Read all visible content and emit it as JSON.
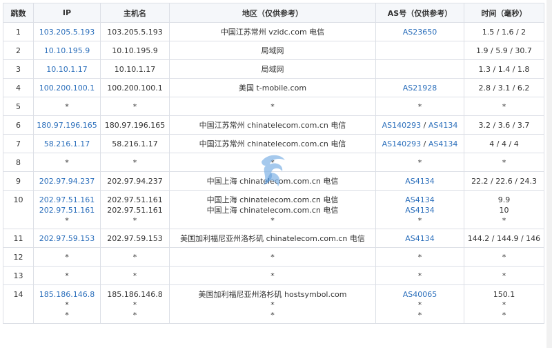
{
  "headers": {
    "hop": "跳数",
    "ip": "IP",
    "host": "主机名",
    "region": "地区（仅供参考）",
    "as": "AS号（仅供参考）",
    "time": "时间（毫秒）"
  },
  "rows": [
    {
      "hop": "1",
      "ips": [
        "103.205.5.193"
      ],
      "hosts": [
        "103.205.5.193"
      ],
      "regions": [
        "中国江苏常州 vzidc.com 电信"
      ],
      "as": [
        [
          "AS23650"
        ]
      ],
      "times": [
        "1.5 / 1.6 / 2"
      ]
    },
    {
      "hop": "2",
      "ips": [
        "10.10.195.9"
      ],
      "hosts": [
        "10.10.195.9"
      ],
      "regions": [
        "局域网"
      ],
      "as": [
        []
      ],
      "times": [
        "1.9 / 5.9 / 30.7"
      ]
    },
    {
      "hop": "3",
      "ips": [
        "10.10.1.17"
      ],
      "hosts": [
        "10.10.1.17"
      ],
      "regions": [
        "局域网"
      ],
      "as": [
        []
      ],
      "times": [
        "1.3 / 1.4 / 1.8"
      ]
    },
    {
      "hop": "4",
      "ips": [
        "100.200.100.1"
      ],
      "hosts": [
        "100.200.100.1"
      ],
      "regions": [
        "美国 t-mobile.com"
      ],
      "as": [
        [
          "AS21928"
        ]
      ],
      "times": [
        "2.8 / 3.1 / 6.2"
      ]
    },
    {
      "hop": "5",
      "ips": [
        "*"
      ],
      "hosts": [
        "*"
      ],
      "regions": [
        "*"
      ],
      "as": [
        [
          "*"
        ]
      ],
      "times": [
        "*"
      ]
    },
    {
      "hop": "6",
      "ips": [
        "180.97.196.165"
      ],
      "hosts": [
        "180.97.196.165"
      ],
      "regions": [
        "中国江苏常州 chinatelecom.com.cn 电信"
      ],
      "as": [
        [
          "AS140293",
          "AS4134"
        ]
      ],
      "times": [
        "3.2 / 3.6 / 3.7"
      ]
    },
    {
      "hop": "7",
      "ips": [
        "58.216.1.17"
      ],
      "hosts": [
        "58.216.1.17"
      ],
      "regions": [
        "中国江苏常州 chinatelecom.com.cn 电信"
      ],
      "as": [
        [
          "AS140293",
          "AS4134"
        ]
      ],
      "times": [
        "4 / 4 / 4"
      ]
    },
    {
      "hop": "8",
      "ips": [
        "*"
      ],
      "hosts": [
        "*"
      ],
      "regions": [
        "*"
      ],
      "as": [
        [
          "*"
        ]
      ],
      "times": [
        "*"
      ]
    },
    {
      "hop": "9",
      "ips": [
        "202.97.94.237"
      ],
      "hosts": [
        "202.97.94.237"
      ],
      "regions": [
        "中国上海 chinatelecom.com.cn 电信"
      ],
      "as": [
        [
          "AS4134"
        ]
      ],
      "times": [
        "22.2 / 22.6 / 24.3"
      ]
    },
    {
      "hop": "10",
      "ips": [
        "202.97.51.161",
        "202.97.51.161",
        "*"
      ],
      "hosts": [
        "202.97.51.161",
        "202.97.51.161",
        "*"
      ],
      "regions": [
        "中国上海 chinatelecom.com.cn 电信",
        "中国上海 chinatelecom.com.cn 电信",
        "*"
      ],
      "as": [
        [
          "AS4134"
        ],
        [
          "AS4134"
        ],
        [
          "*"
        ]
      ],
      "times": [
        "9.9",
        "10",
        "*"
      ]
    },
    {
      "hop": "11",
      "ips": [
        "202.97.59.153"
      ],
      "hosts": [
        "202.97.59.153"
      ],
      "regions": [
        "美国加利福尼亚州洛杉矶 chinatelecom.com.cn 电信"
      ],
      "as": [
        [
          "AS4134"
        ]
      ],
      "times": [
        "144.2 / 144.9 / 146"
      ]
    },
    {
      "hop": "12",
      "ips": [
        "*"
      ],
      "hosts": [
        "*"
      ],
      "regions": [
        "*"
      ],
      "as": [
        [
          "*"
        ]
      ],
      "times": [
        "*"
      ]
    },
    {
      "hop": "13",
      "ips": [
        "*"
      ],
      "hosts": [
        "*"
      ],
      "regions": [
        "*"
      ],
      "as": [
        [
          "*"
        ]
      ],
      "times": [
        "*"
      ]
    },
    {
      "hop": "14",
      "ips": [
        "185.186.146.8",
        "*",
        "*"
      ],
      "hosts": [
        "185.186.146.8",
        "*",
        "*"
      ],
      "regions": [
        "美国加利福尼亚州洛杉矶 hostsymbol.com",
        "*",
        "*"
      ],
      "as": [
        [
          "AS40065"
        ],
        [
          "*"
        ],
        [
          "*"
        ]
      ],
      "times": [
        "150.1",
        "*",
        "*"
      ]
    }
  ],
  "colors": {
    "link": "#2a6ebb",
    "header_bg": "#f5f7fa",
    "border": "#dcdfe6"
  },
  "watermark_icon": "wave-logo-icon"
}
